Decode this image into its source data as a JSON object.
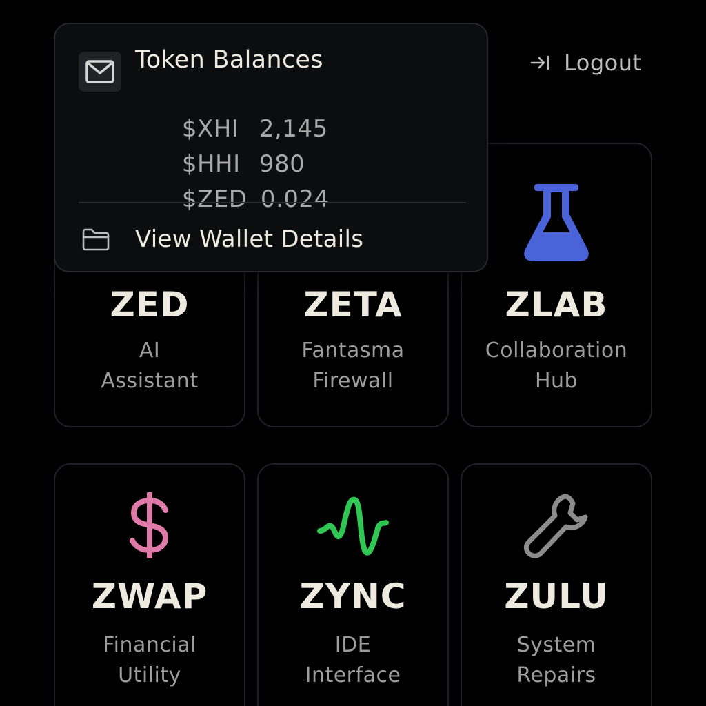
{
  "header": {
    "logout_label": "Logout"
  },
  "token_popover": {
    "title": "Token Balances",
    "balances": [
      {
        "symbol": "$XHI",
        "amount": "2,145"
      },
      {
        "symbol": "$HHI",
        "amount": "980"
      },
      {
        "symbol": "$ZED",
        "amount": "0.024"
      }
    ],
    "wallet_link_label": "View Wallet Details",
    "icons": {
      "header": "mail-icon",
      "link": "folder-icon"
    }
  },
  "apps": [
    {
      "name": "ZED",
      "desc_line1": "AI",
      "desc_line2": "Assistant"
    },
    {
      "name": "ZETA",
      "desc_line1": "Fantasma",
      "desc_line2": "Firewall"
    },
    {
      "name": "ZLAB",
      "desc_line1": "Collaboration",
      "desc_line2": "Hub",
      "icon": "flask-icon",
      "icon_color": "#4a63d8"
    },
    {
      "name": "ZWAP",
      "desc_line1": "Financial",
      "desc_line2": "Utility",
      "icon": "dollar-icon",
      "icon_color": "#e07aa8"
    },
    {
      "name": "ZYNC",
      "desc_line1": "IDE",
      "desc_line2": "Interface",
      "icon": "pulse-wave-icon",
      "icon_color": "#2fc653"
    },
    {
      "name": "ZULU",
      "desc_line1": "System",
      "desc_line2": "Repairs",
      "icon": "wrench-icon",
      "icon_color": "#8c8c8c"
    }
  ],
  "colors": {
    "background": "#000000",
    "tile_border": "#1d2026",
    "title_text": "#eeeae0",
    "muted_text": "#9d9d9d"
  }
}
